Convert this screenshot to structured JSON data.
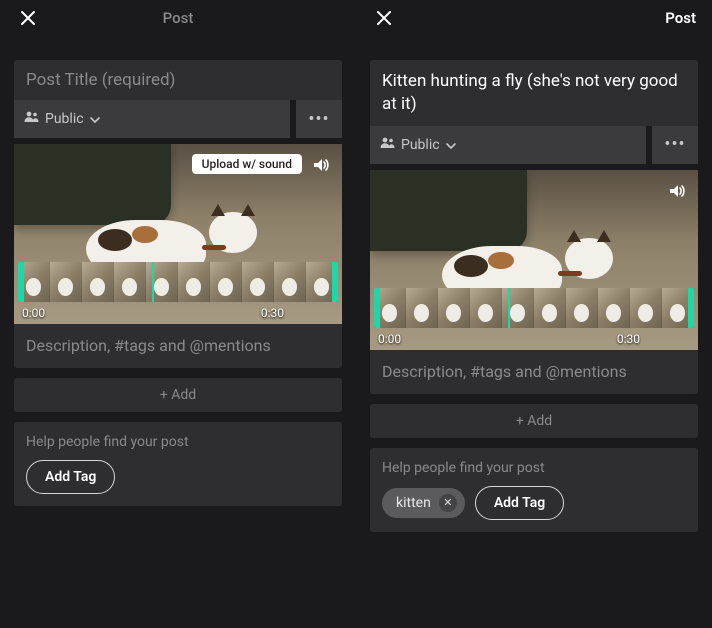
{
  "left": {
    "header": {
      "postLabel": "Post"
    },
    "titlePlaceholder": "Post Title (required)",
    "titleValue": "",
    "privacyLabel": "Public",
    "uploadSoundLabel": "Upload w/ sound",
    "time": {
      "start": "0:00",
      "end": "0:30"
    },
    "descriptionPlaceholder": "Description, #tags and @mentions",
    "addLabel": "+ Add",
    "tagHelp": "Help people find your post",
    "addTagLabel": "Add Tag",
    "tags": []
  },
  "right": {
    "header": {
      "postLabel": "Post"
    },
    "titleValue": "Kitten hunting a fly (she's not very good at it)",
    "privacyLabel": "Public",
    "time": {
      "start": "0:00",
      "end": "0:30"
    },
    "descriptionPlaceholder": "Description, #tags and @mentions",
    "addLabel": "+ Add",
    "tagHelp": "Help people find your post",
    "addTagLabel": "Add Tag",
    "tags": [
      "kitten"
    ]
  }
}
